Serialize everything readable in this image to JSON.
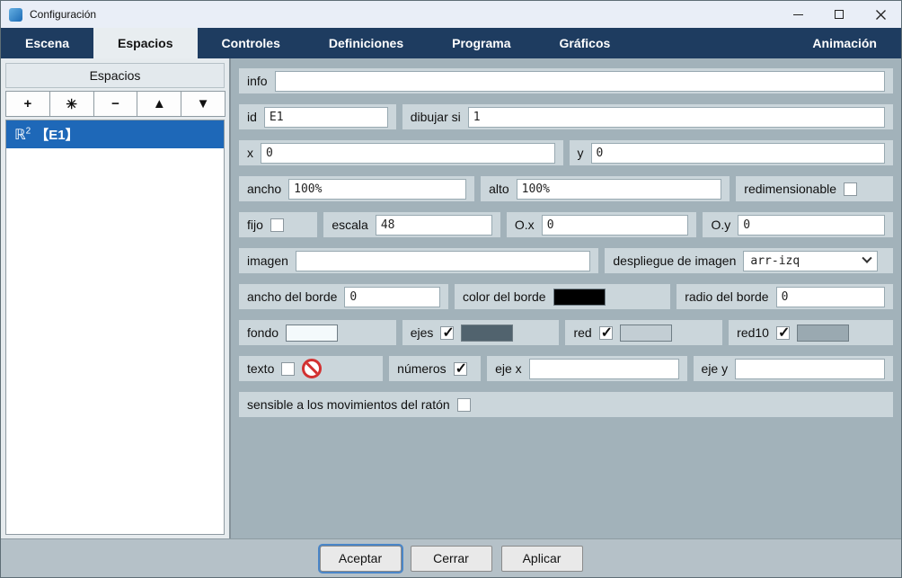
{
  "window": {
    "title": "Configuración"
  },
  "tabs": [
    {
      "label": "Escena",
      "active": false
    },
    {
      "label": "Espacios",
      "active": true
    },
    {
      "label": "Controles",
      "active": false
    },
    {
      "label": "Definiciones",
      "active": false
    },
    {
      "label": "Programa",
      "active": false
    },
    {
      "label": "Gráficos",
      "active": false
    },
    {
      "label": "Animación",
      "active": false
    }
  ],
  "sidebar": {
    "title": "Espacios",
    "toolbar": {
      "add": "+",
      "duplicate": "✳",
      "remove": "−",
      "move_up": "▲",
      "move_down": "▼"
    },
    "list": [
      {
        "type": "ℝ",
        "exponent": "2",
        "name": "【E1】",
        "selected": true
      }
    ]
  },
  "form": {
    "info": {
      "label": "info",
      "value": ""
    },
    "id": {
      "label": "id",
      "value": "E1"
    },
    "dibujar_si": {
      "label": "dibujar si",
      "value": "1"
    },
    "x": {
      "label": "x",
      "value": "0"
    },
    "y": {
      "label": "y",
      "value": "0"
    },
    "ancho": {
      "label": "ancho",
      "value": "100%"
    },
    "alto": {
      "label": "alto",
      "value": "100%"
    },
    "redimensionable": {
      "label": "redimensionable",
      "checked": false
    },
    "fijo": {
      "label": "fijo",
      "checked": false
    },
    "escala": {
      "label": "escala",
      "value": "48"
    },
    "ox": {
      "label": "O.x",
      "value": "0"
    },
    "oy": {
      "label": "O.y",
      "value": "0"
    },
    "imagen": {
      "label": "imagen",
      "value": ""
    },
    "despliegue": {
      "label": "despliegue de imagen",
      "value": "arr-izq"
    },
    "ancho_borde": {
      "label": "ancho del borde",
      "value": "0"
    },
    "color_borde": {
      "label": "color del borde",
      "color": "#000000"
    },
    "radio_borde": {
      "label": "radio del borde",
      "value": "0"
    },
    "fondo": {
      "label": "fondo",
      "color": "#f4fafc"
    },
    "ejes": {
      "label": "ejes",
      "checked": true,
      "color": "#51636e"
    },
    "red": {
      "label": "red",
      "checked": true,
      "color": "#c3ced4"
    },
    "red10": {
      "label": "red10",
      "checked": true,
      "color": "#9aa9b1"
    },
    "texto": {
      "label": "texto",
      "checked": false
    },
    "numeros": {
      "label": "números",
      "checked": true
    },
    "eje_x": {
      "label": "eje x",
      "value": ""
    },
    "eje_y": {
      "label": "eje y",
      "value": ""
    },
    "sensible": {
      "label": "sensible a los movimientos del ratón",
      "checked": false
    }
  },
  "footer": {
    "accept": "Aceptar",
    "close": "Cerrar",
    "apply": "Aplicar"
  },
  "theme": {
    "tab_bar": "#1e3c60",
    "selection": "#1e68b8",
    "panel": "#a2b2ba",
    "group": "#cbd6db"
  }
}
